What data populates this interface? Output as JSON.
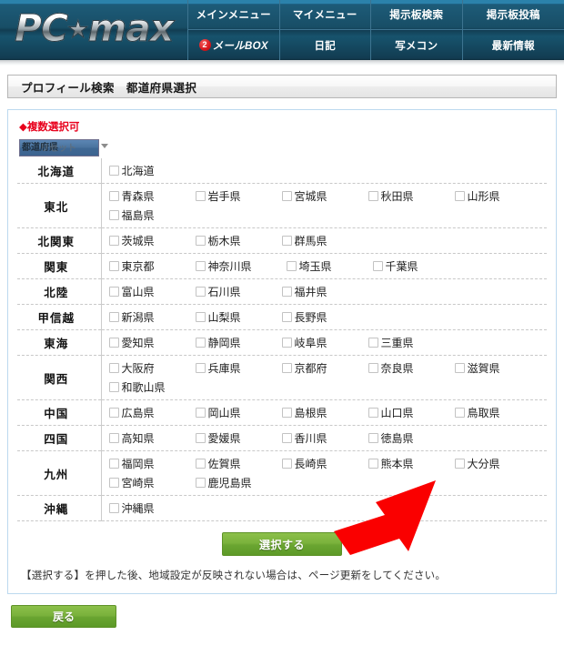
{
  "header": {
    "logo_text": "PC",
    "logo_star": "★",
    "logo_text2": "max",
    "nav_row1": [
      {
        "label": "メインメニュー",
        "name": "nav-main-menu"
      },
      {
        "label": "マイメニュー",
        "name": "nav-my-menu"
      },
      {
        "label": "掲示板検索",
        "name": "nav-board-search"
      },
      {
        "label": "掲示板投稿",
        "name": "nav-board-post"
      }
    ],
    "nav_row2": [
      {
        "label": "メールBOX",
        "badge": "2",
        "name": "nav-mailbox"
      },
      {
        "label": "日記",
        "name": "nav-diary"
      },
      {
        "label": "写メコン",
        "name": "nav-photo-contest"
      },
      {
        "label": "最新情報",
        "name": "nav-latest-info"
      }
    ]
  },
  "page_title": "プロフィール検索　都道府県選択",
  "panel": {
    "multi_select_note": "◆複数選択可",
    "reset_select_label": "都道府県",
    "reset_select_ghost": "リセット",
    "submit_label": "選択する",
    "note": "【選択する】を押した後、地域設定が反映されない場合は、ページ更新をしてください。"
  },
  "back_button_label": "戻る",
  "colors": {
    "header_bg": "#123d52",
    "header_top_strip": "#2b82ab",
    "accent_red": "#e8001c",
    "button_green": "#7ab23c",
    "panel_border": "#bcd9ef",
    "arrow_red": "#fa0000"
  },
  "regions": [
    {
      "name": "北海道",
      "prefectures": [
        "北海道"
      ]
    },
    {
      "name": "東北",
      "prefectures": [
        "青森県",
        "岩手県",
        "宮城県",
        "秋田県",
        "山形県",
        "福島県"
      ]
    },
    {
      "name": "北関東",
      "prefectures": [
        "茨城県",
        "栃木県",
        "群馬県"
      ]
    },
    {
      "name": "関東",
      "prefectures": [
        "東京都",
        "神奈川県",
        "埼玉県",
        "千葉県"
      ]
    },
    {
      "name": "北陸",
      "prefectures": [
        "富山県",
        "石川県",
        "福井県"
      ]
    },
    {
      "name": "甲信越",
      "prefectures": [
        "新潟県",
        "山梨県",
        "長野県"
      ]
    },
    {
      "name": "東海",
      "prefectures": [
        "愛知県",
        "静岡県",
        "岐阜県",
        "三重県"
      ]
    },
    {
      "name": "関西",
      "prefectures": [
        "大阪府",
        "兵庫県",
        "京都府",
        "奈良県",
        "滋賀県",
        "和歌山県"
      ]
    },
    {
      "name": "中国",
      "prefectures": [
        "広島県",
        "岡山県",
        "島根県",
        "山口県",
        "鳥取県"
      ]
    },
    {
      "name": "四国",
      "prefectures": [
        "高知県",
        "愛媛県",
        "香川県",
        "徳島県"
      ]
    },
    {
      "name": "九州",
      "prefectures": [
        "福岡県",
        "佐賀県",
        "長崎県",
        "熊本県",
        "大分県",
        "宮崎県",
        "鹿児島県"
      ]
    },
    {
      "name": "沖縄",
      "prefectures": [
        "沖縄県"
      ]
    }
  ]
}
